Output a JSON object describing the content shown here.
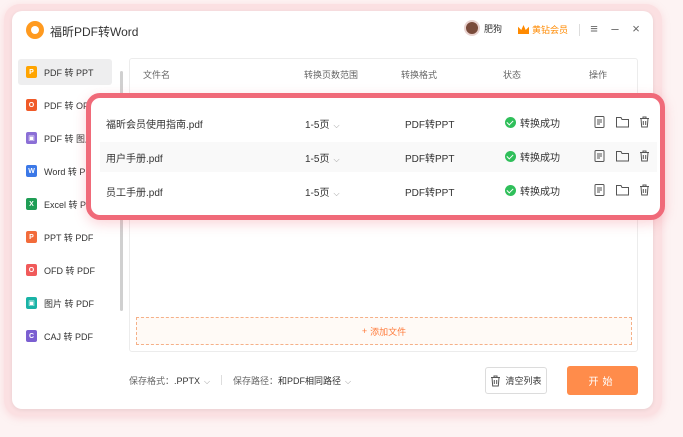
{
  "app": {
    "title": "福昕PDF转Word"
  },
  "header": {
    "user_name": "肥狗",
    "vip_label": "黄钻会员",
    "menu_icon": "≡",
    "minimize_icon": "–",
    "close_icon": "×"
  },
  "sidebar": {
    "items": [
      {
        "label": "PDF 转 PPT",
        "icon_letter": "P",
        "color": "#ffa400",
        "active": true
      },
      {
        "label": "PDF 转 OFD",
        "icon_letter": "O",
        "color": "#f05a28"
      },
      {
        "label": "PDF 转 图片",
        "icon_letter": "▣",
        "color": "#8b6fd6"
      },
      {
        "label": "Word 转 PDF",
        "icon_letter": "W",
        "color": "#3b78e7"
      },
      {
        "label": "Excel 转 PDF",
        "icon_letter": "X",
        "color": "#1f9d55"
      },
      {
        "label": "PPT 转 PDF",
        "icon_letter": "P",
        "color": "#f26b3a"
      },
      {
        "label": "OFD 转 PDF",
        "icon_letter": "O",
        "color": "#f05a5a"
      },
      {
        "label": "图片 转 PDF",
        "icon_letter": "▣",
        "color": "#19b3a6"
      },
      {
        "label": "CAJ 转 PDF",
        "icon_letter": "C",
        "color": "#7b5fd1"
      }
    ]
  },
  "table": {
    "headers": {
      "name": "文件名",
      "range": "转换页数范围",
      "format": "转换格式",
      "status": "状态",
      "action": "操作"
    },
    "rows": [
      {
        "name": "福昕会员使用指南.pdf",
        "range": "1-5页",
        "format": "PDF转PPT",
        "status": "转换成功"
      },
      {
        "name": "用户手册.pdf",
        "range": "1-5页",
        "format": "PDF转PPT",
        "status": "转换成功"
      },
      {
        "name": "员工手册.pdf",
        "range": "1-5页",
        "format": "PDF转PPT",
        "status": "转换成功"
      }
    ]
  },
  "add_file": {
    "label": "添加文件",
    "plus": "+"
  },
  "footer": {
    "save_format_label": "保存格式：",
    "save_format_value": ".PPTX",
    "save_path_label": "保存路径：",
    "save_path_value": "和PDF相同路径",
    "clear_label": "清空列表",
    "start_label": "开始"
  },
  "colors": {
    "accent": "#ff8c4b",
    "highlight_border": "#f06a79",
    "success": "#2fbf5a",
    "vip": "#ff8a00"
  }
}
